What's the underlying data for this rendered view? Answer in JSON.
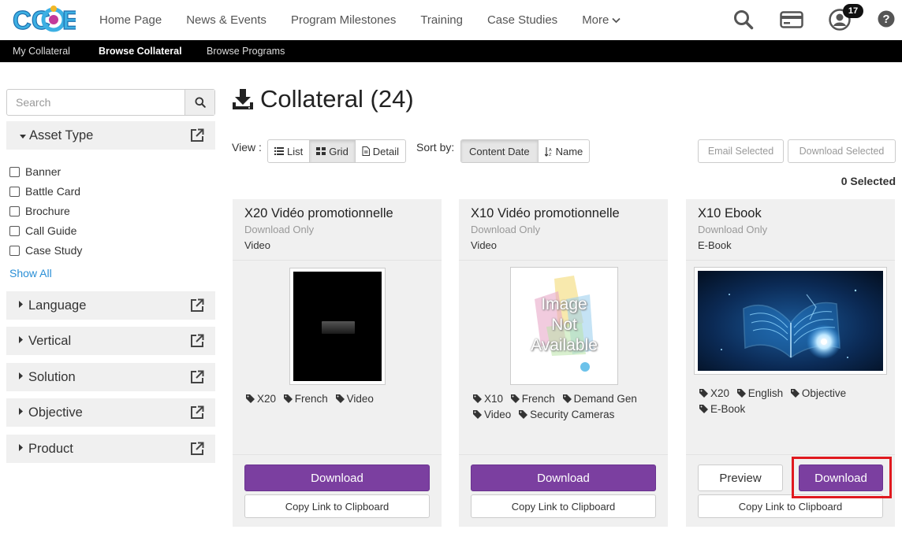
{
  "brand": {
    "logo_text": "CCOE",
    "accent": "#7b3fa0",
    "link_color": "#2a8fd6",
    "highlight": "#e0191f"
  },
  "nav": {
    "links": [
      "Home Page",
      "News & Events",
      "Program Milestones",
      "Training",
      "Case Studies"
    ],
    "more_label": "More",
    "notification_count": "17",
    "icons": [
      "search-icon",
      "credit-card-icon",
      "user-icon",
      "help-icon"
    ]
  },
  "subnav": {
    "items": [
      "My Collateral",
      "Browse Collateral",
      "Browse Programs"
    ],
    "active": "Browse Collateral"
  },
  "sidebar": {
    "search_placeholder": "Search",
    "asset_type": {
      "label": "Asset Type",
      "options": [
        "Banner",
        "Battle Card",
        "Brochure",
        "Call Guide",
        "Case Study"
      ],
      "show_all": "Show All"
    },
    "facets": [
      "Language",
      "Vertical",
      "Solution",
      "Objective",
      "Product"
    ]
  },
  "main": {
    "title": "Collateral (24)",
    "view_label": "View :",
    "view_options": [
      "List",
      "Grid",
      "Detail"
    ],
    "view_active": "Grid",
    "sort_label": "Sort by:",
    "sort_options": [
      "Content Date",
      "Name"
    ],
    "sort_active": "Content Date",
    "email_selected": "Email Selected",
    "download_selected": "Download Selected",
    "selected_count": "0 Selected"
  },
  "cards": [
    {
      "name": "X20 Vidéo promotionnelle",
      "access": "Download Only",
      "file_type": "Video",
      "tags": [
        "X20",
        "French",
        "Video"
      ],
      "thumb": "black-video",
      "primary_label": "Download",
      "copy_label": "Copy Link to Clipboard"
    },
    {
      "name": "X10 Vidéo promotionnelle",
      "access": "Download Only",
      "file_type": "Video",
      "tags": [
        "X10",
        "French",
        "Demand Gen",
        "Video",
        "Security Cameras"
      ],
      "thumb_text": [
        "Image",
        "Not",
        "Available"
      ],
      "primary_label": "Download",
      "copy_label": "Copy Link to Clipboard"
    },
    {
      "name": "X10 Ebook",
      "access": "Download Only",
      "file_type": "E-Book",
      "tags": [
        "X20",
        "English",
        "Objective",
        "E-Book"
      ],
      "thumb": "glowing-book",
      "preview_label": "Preview",
      "primary_label": "Download",
      "copy_label": "Copy Link to Clipboard"
    }
  ]
}
